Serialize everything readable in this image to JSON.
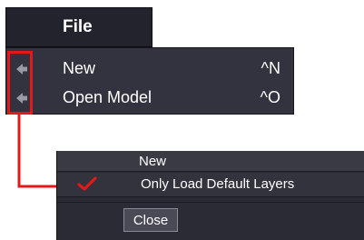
{
  "menu": {
    "title": "File",
    "items": [
      {
        "label": "New",
        "shortcut": "^N",
        "icon": "menu-arrow-icon"
      },
      {
        "label": "Open Model",
        "shortcut": "^O",
        "icon": "menu-arrow-icon"
      }
    ]
  },
  "dialog": {
    "title": "New",
    "option": {
      "label": "Only Load Default Layers",
      "checked": true
    },
    "close_label": "Close"
  },
  "colors": {
    "highlight": "#e01a1a",
    "menu_bg": "#33333f",
    "dialog_bg": "#2b2b35"
  }
}
